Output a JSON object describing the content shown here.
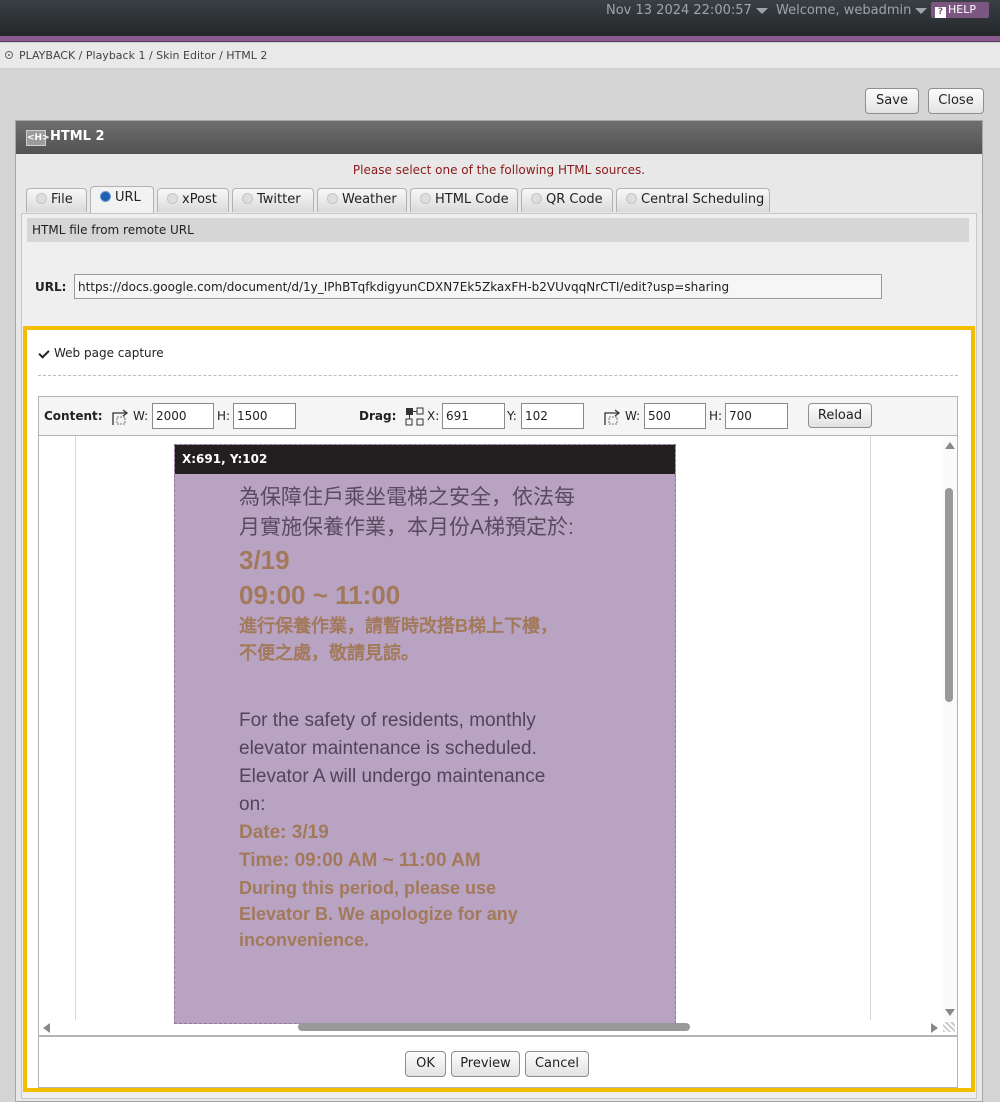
{
  "topbar": {
    "datetime": "Nov 13 2024 22:00:57",
    "welcome": "Welcome, webadmin",
    "help_label": "HELP"
  },
  "breadcrumb": "PLAYBACK / Playback 1 / Skin Editor / HTML 2",
  "actions": {
    "save": "Save",
    "close": "Close"
  },
  "panel": {
    "title": "HTML 2",
    "icon_text": "<H>",
    "notice": "Please select one of the following HTML sources."
  },
  "tabs": [
    {
      "label": "File",
      "selected": false
    },
    {
      "label": "URL",
      "selected": true
    },
    {
      "label": "xPost",
      "selected": false
    },
    {
      "label": "Twitter",
      "selected": false
    },
    {
      "label": "Weather",
      "selected": false
    },
    {
      "label": "HTML Code",
      "selected": false
    },
    {
      "label": "QR Code",
      "selected": false
    },
    {
      "label": "Central Scheduling",
      "selected": false
    }
  ],
  "url_section": {
    "subheading": "HTML file from remote URL",
    "url_label": "URL:",
    "url_value": "https://docs.google.com/document/d/1y_IPhBTqfkdigyunCDXN7Ek5ZkaxFH-b2VUvqqNrCTI/edit?usp=sharing"
  },
  "capture": {
    "label": "Web page capture",
    "checked": true,
    "content_label": "Content:",
    "content_w": "2000",
    "content_h": "1500",
    "drag_label": "Drag:",
    "drag_x": "691",
    "drag_y": "102",
    "size_w": "500",
    "size_h": "700",
    "w_label": "W:",
    "h_label": "H:",
    "x_label": "X:",
    "y_label": "Y:",
    "reload": "Reload",
    "frame_caption": "X:691, Y:102"
  },
  "preview_text": {
    "zh_line1": "為保障住戶乘坐電梯之安全，依法每",
    "zh_line2": "月實施保養作業，本月份A梯預定於:",
    "zh_date": "3/19",
    "zh_time": "09:00 ~ 11:00",
    "zh_note1": "進行保養作業，請暫時改搭B梯上下樓，",
    "zh_note2": "不便之處，敬請見諒。",
    "en_line1": "For the safety of residents, monthly",
    "en_line2": "elevator maintenance is scheduled.",
    "en_line3": "Elevator A will undergo maintenance",
    "en_line4": "on:",
    "en_date": "Date: 3/19",
    "en_time": "Time: 09:00 AM ~ 11:00 AM",
    "en_note1": "During this period, please use",
    "en_note2": "Elevator B. We apologize for any",
    "en_note3": "inconvenience."
  },
  "dialog_buttons": {
    "ok": "OK",
    "preview": "Preview",
    "cancel": "Cancel"
  },
  "colors": {
    "highlight_border": "#f4bd00",
    "preview_bg": "#b9a3c2",
    "accent_text": "#a27a5b"
  }
}
